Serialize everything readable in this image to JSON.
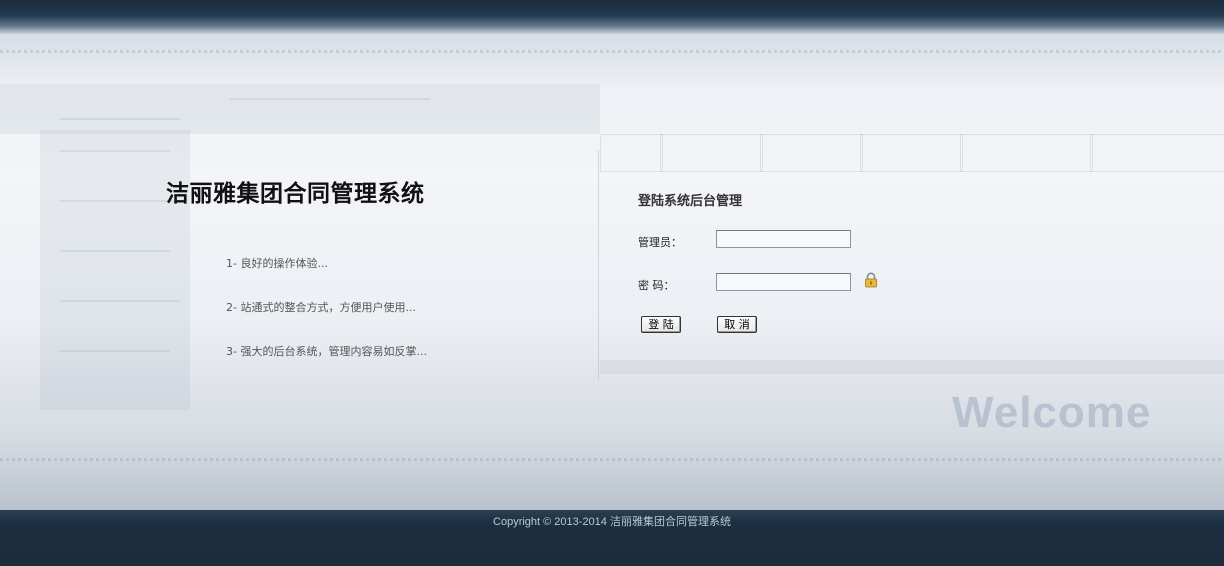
{
  "system": {
    "title": "洁丽雅集团合同管理系统"
  },
  "features": [
    "1- 良好的操作体验...",
    "2- 站通式的整合方式，方便用户使用...",
    "3- 强大的后台系统，管理内容易如反掌..."
  ],
  "login": {
    "title": "登陆系统后台管理",
    "admin_label": "管理员：",
    "admin_value": "",
    "password_label": "密 码：",
    "password_value": "",
    "login_button": "登 陆",
    "cancel_button": "取 消"
  },
  "background_text": "Welcome",
  "footer": {
    "copyright": "Copyright © 2013-2014 洁丽雅集团合同管理系统"
  },
  "icons": {
    "lock": "lock-icon"
  },
  "colors": {
    "top_band": "#1c2c3c",
    "bottom_band": "#1b2c3b",
    "background": "#eef1f5"
  }
}
